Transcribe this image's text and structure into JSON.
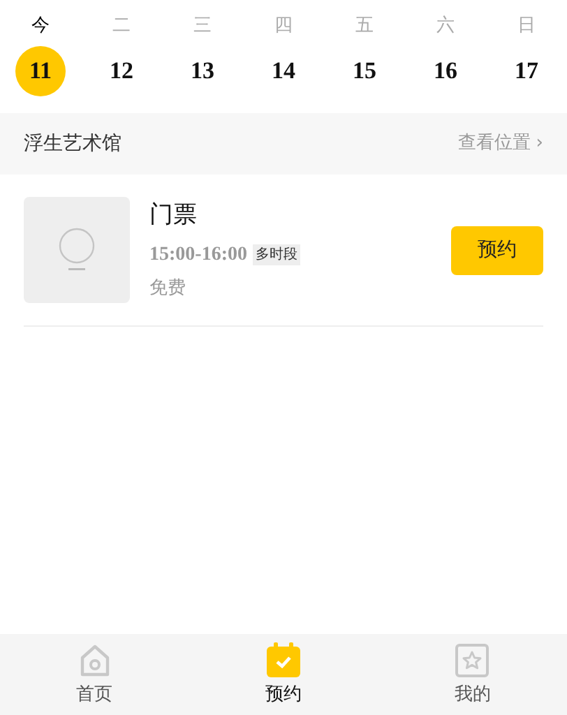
{
  "week": [
    {
      "weekday": "今",
      "day": "11",
      "selected": true
    },
    {
      "weekday": "二",
      "day": "12",
      "selected": false
    },
    {
      "weekday": "三",
      "day": "13",
      "selected": false
    },
    {
      "weekday": "四",
      "day": "14",
      "selected": false
    },
    {
      "weekday": "五",
      "day": "15",
      "selected": false
    },
    {
      "weekday": "六",
      "day": "16",
      "selected": false
    },
    {
      "weekday": "日",
      "day": "17",
      "selected": false
    }
  ],
  "venue": {
    "name": "浮生艺术馆",
    "link": "查看位置",
    "chevron": "›"
  },
  "tickets": [
    {
      "title": "门票",
      "time": "15:00-16:00",
      "tag": "多时段",
      "price": "免费",
      "button": "预约"
    }
  ],
  "tab_bar": [
    {
      "kind": "home",
      "label": "首页",
      "selected": false
    },
    {
      "kind": "calendar",
      "label": "预约",
      "selected": true
    },
    {
      "kind": "star",
      "label": "我的",
      "selected": false
    }
  ]
}
